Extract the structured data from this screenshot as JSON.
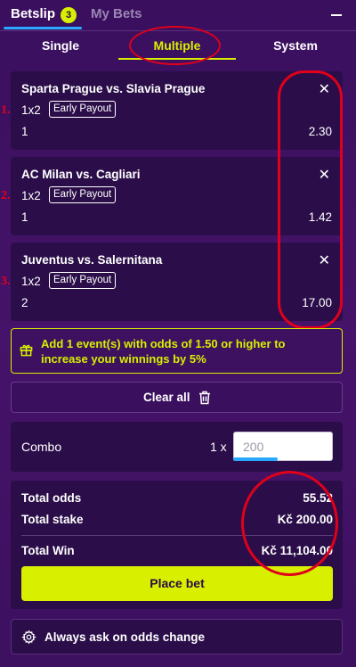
{
  "header": {
    "tabs": [
      {
        "label": "Betslip",
        "active": true,
        "badge": "3"
      },
      {
        "label": "My Bets",
        "active": false
      }
    ],
    "collapse_icon": "minus-icon"
  },
  "subtabs": [
    {
      "label": "Single",
      "active": false
    },
    {
      "label": "Multiple",
      "active": true
    },
    {
      "label": "System",
      "active": false
    }
  ],
  "events": [
    {
      "annotation": "1.",
      "title": "Sparta Prague vs. Slavia Prague",
      "market": "1x2",
      "badge": "Early Payout",
      "pick": "1",
      "odds": "2.30"
    },
    {
      "annotation": "2.",
      "title": "AC Milan vs. Cagliari",
      "market": "1x2",
      "badge": "Early Payout",
      "pick": "1",
      "odds": "1.42"
    },
    {
      "annotation": "3.",
      "title": "Juventus vs. Salernitana",
      "market": "1x2",
      "badge": "Early Payout",
      "pick": "2",
      "odds": "17.00"
    }
  ],
  "promo": {
    "icon": "gift-icon",
    "text": "Add 1 event(s) with odds of 1.50 or higher to increase your winnings by 5%"
  },
  "clear_all": {
    "label": "Clear all",
    "icon": "trash-icon"
  },
  "combo": {
    "label": "Combo",
    "multiplier": "1 x",
    "stake_placeholder": "200"
  },
  "summary": {
    "total_odds_label": "Total odds",
    "total_odds": "55.52",
    "total_stake_label": "Total stake",
    "total_stake": "Kč 200.00",
    "total_win_label": "Total Win",
    "total_win": "Kč 11,104.00"
  },
  "place_bet": {
    "label": "Place bet"
  },
  "odds_change": {
    "label": "Always ask on odds change",
    "icon": "gear-icon"
  },
  "colors": {
    "accent": "#d8f000",
    "background": "#3a0f5e",
    "card": "#2b0e49",
    "annotation": "#e0001b",
    "underline": "#2aa7ff"
  }
}
